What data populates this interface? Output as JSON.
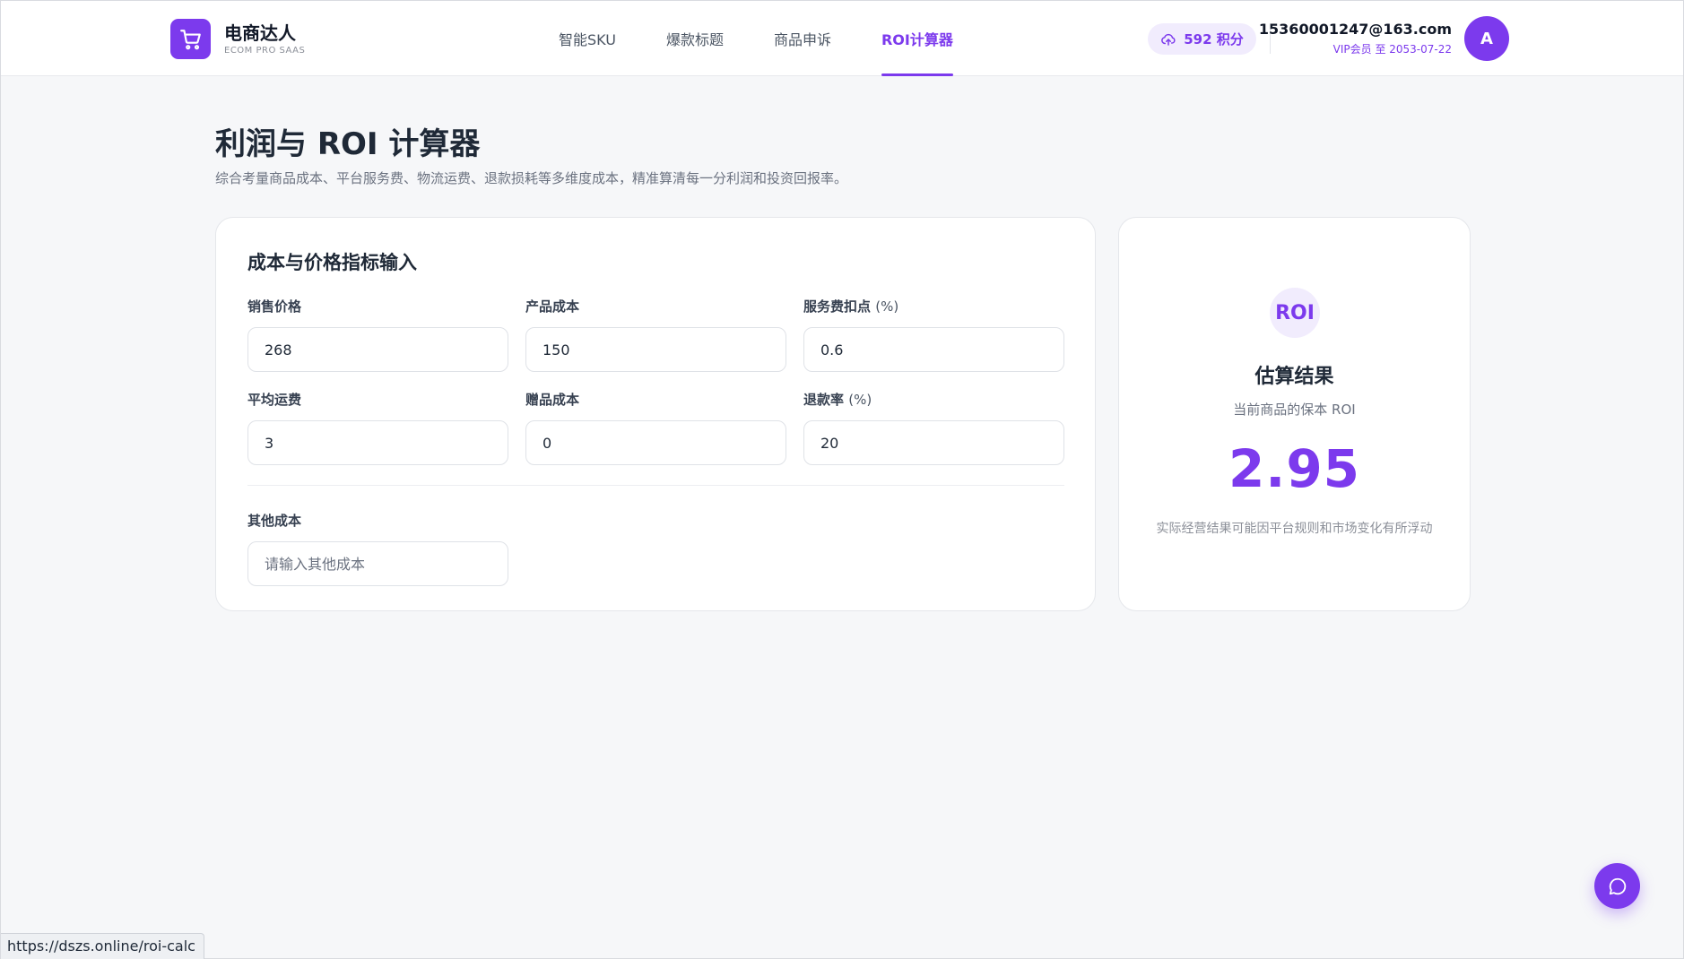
{
  "brand": {
    "name": "电商达人",
    "subtitle": "ECOM PRO SAAS"
  },
  "nav": {
    "items": [
      {
        "label": "智能SKU",
        "active": false
      },
      {
        "label": "爆款标题",
        "active": false
      },
      {
        "label": "商品申诉",
        "active": false
      },
      {
        "label": "ROI计算器",
        "active": true
      }
    ]
  },
  "account": {
    "points_label": "592 积分",
    "email": "15360001247@163.com",
    "vip": "VIP会员 至 2053-07-22",
    "avatar_letter": "A"
  },
  "page": {
    "title": "利润与 ROI 计算器",
    "description": "综合考量商品成本、平台服务费、物流运费、退款损耗等多维度成本，精准算清每一分利润和投资回报率。"
  },
  "input_card": {
    "title": "成本与价格指标输入",
    "fields": {
      "sale_price": {
        "label": "销售价格",
        "value": "268"
      },
      "product_cost": {
        "label": "产品成本",
        "value": "150"
      },
      "service_fee": {
        "label": "服务费扣点",
        "unit": "(%)",
        "value": "0.6"
      },
      "shipping": {
        "label": "平均运费",
        "value": "3"
      },
      "gift_cost": {
        "label": "赠品成本",
        "value": "0"
      },
      "refund_rate": {
        "label": "退款率",
        "unit": "(%)",
        "value": "20"
      },
      "other_cost": {
        "label": "其他成本",
        "value": "",
        "placeholder": "请输入其他成本"
      }
    }
  },
  "result_card": {
    "badge": "ROI",
    "title": "估算结果",
    "subtitle": "当前商品的保本 ROI",
    "value": "2.95",
    "note": "实际经营结果可能因平台规则和市场变化有所浮动"
  },
  "status_bar": {
    "url": "https://dszs.online/roi-calc"
  },
  "icons": {
    "brand": "shopping-cart-icon",
    "points": "cloud-upload-icon",
    "chat": "chat-bubble-icon"
  },
  "colors": {
    "accent": "#7c3aed",
    "background": "#f6f7f9"
  }
}
